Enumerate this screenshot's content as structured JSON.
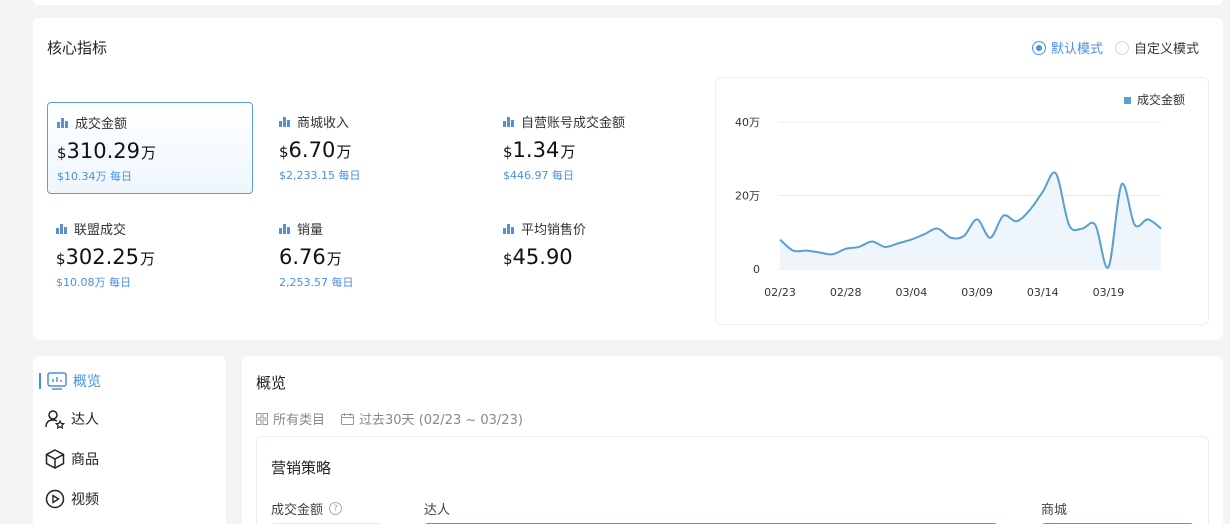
{
  "core": {
    "title": "核心指标",
    "modes": [
      {
        "label": "默认模式",
        "selected": true
      },
      {
        "label": "自定义模式",
        "selected": false
      }
    ],
    "metrics": [
      {
        "label": "成交金额",
        "currency": "$",
        "value": "310.29",
        "unit": "万",
        "sub": "$10.34万 每日",
        "selected": true
      },
      {
        "label": "商城收入",
        "currency": "$",
        "value": "6.70",
        "unit": "万",
        "sub": "$2,233.15 每日",
        "selected": false
      },
      {
        "label": "自营账号成交金额",
        "currency": "$",
        "value": "1.34",
        "unit": "万",
        "sub": "$446.97 每日",
        "selected": false
      },
      {
        "label": "联盟成交",
        "currency": "$",
        "value": "302.25",
        "unit": "万",
        "sub": "$10.08万 每日",
        "selected": false
      },
      {
        "label": "销量",
        "currency": "",
        "value": "6.76",
        "unit": "万",
        "sub": "2,253.57 每日",
        "selected": false
      },
      {
        "label": "平均销售价",
        "currency": "$",
        "value": "45.90",
        "unit": "",
        "sub": "",
        "selected": false
      }
    ]
  },
  "chart_data": {
    "type": "area",
    "title": "",
    "xlabel": "",
    "ylabel": "",
    "ylim": [
      0,
      40
    ],
    "yticks": [
      0,
      20,
      40
    ],
    "ytick_labels": [
      "0",
      "20万",
      "40万"
    ],
    "xtick_labels": [
      "02/23",
      "02/28",
      "03/04",
      "03/09",
      "03/14",
      "03/19"
    ],
    "xtick_index": [
      0,
      5,
      10,
      15,
      20,
      25
    ],
    "grid": true,
    "legend": "top-right",
    "series": [
      {
        "name": "成交金额",
        "color": "#5b9fd1",
        "values": [
          8,
          5,
          5,
          4.5,
          4,
          5.5,
          6,
          7.5,
          6,
          7,
          8,
          9.5,
          11,
          8.5,
          9,
          13.5,
          8.5,
          14.5,
          13,
          16,
          21,
          26,
          12,
          11,
          12,
          0.5,
          23,
          12,
          13.5,
          11
        ]
      }
    ]
  },
  "sidebar": {
    "items": [
      {
        "label": "概览",
        "icon": "overview-icon",
        "active": true
      },
      {
        "label": "达人",
        "icon": "creator-icon",
        "active": false
      },
      {
        "label": "商品",
        "icon": "box-icon",
        "active": false
      },
      {
        "label": "视频",
        "icon": "play-icon",
        "active": false
      }
    ]
  },
  "overview": {
    "title": "概览",
    "category_filter": "所有类目",
    "date_filter": "过去30天 (02/23 ~ 03/23)",
    "strategy": {
      "title": "营销策略",
      "metric_label": "成交金额",
      "help": "?",
      "col_creator": "达人",
      "col_mall": "商城"
    }
  },
  "colors": {
    "accent": "#4a90e2",
    "line": "#5b9fd1",
    "green": "#5aa86a",
    "purple": "#8f7ad6"
  }
}
